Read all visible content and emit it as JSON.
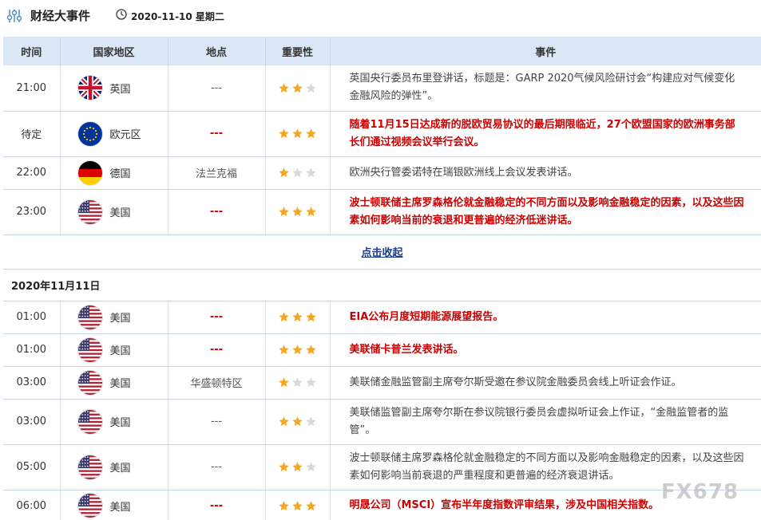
{
  "header": {
    "title": "财经大事件",
    "date": "2020-11-10 星期二"
  },
  "columns": [
    "时间",
    "国家地区",
    "地点",
    "重要性",
    "事件"
  ],
  "rows_day1": [
    {
      "time": "21:00",
      "country": "英国",
      "flag": "uk",
      "place": "---",
      "place_red": false,
      "stars": 2,
      "event": "英国央行委员布里登讲话，标题是：GARP 2020气候风险研讨会“构建应对气候变化金融风险的弹性”。",
      "important": false
    },
    {
      "time": "待定",
      "country": "欧元区",
      "flag": "eu",
      "place": "---",
      "place_red": true,
      "stars": 3,
      "event": "随着11月15日达成新的脱欧贸易协议的最后期限临近，27个欧盟国家的欧洲事务部长们通过视频会议举行会议。",
      "important": true
    },
    {
      "time": "22:00",
      "country": "德国",
      "flag": "de",
      "place": "法兰克福",
      "place_red": false,
      "stars": 1,
      "event": "欧洲央行管委诺特在瑞银欧洲线上会议发表讲话。",
      "important": false
    },
    {
      "time": "23:00",
      "country": "美国",
      "flag": "us",
      "place": "---",
      "place_red": true,
      "stars": 3,
      "event": "波士顿联储主席罗森格伦就金融稳定的不同方面以及影响金融稳定的因素，以及这些因素如何影响当前的衰退和更普遍的经济低迷讲话。",
      "important": true
    }
  ],
  "collapse_label": "点击收起",
  "day2_label": "2020年11月11日",
  "rows_day2": [
    {
      "time": "01:00",
      "country": "美国",
      "flag": "us",
      "place": "---",
      "place_red": true,
      "stars": 3,
      "event": "EIA公布月度短期能源展望报告。",
      "important": true
    },
    {
      "time": "01:00",
      "country": "美国",
      "flag": "us",
      "place": "---",
      "place_red": true,
      "stars": 3,
      "event": "美联储卡普兰发表讲话。",
      "important": true
    },
    {
      "time": "03:00",
      "country": "美国",
      "flag": "us",
      "place": "华盛顿特区",
      "place_red": false,
      "stars": 1,
      "event": "美联储金融监管副主席夸尔斯受邀在参议院金融委员会线上听证会作证。",
      "important": false
    },
    {
      "time": "03:00",
      "country": "美国",
      "flag": "us",
      "place": "---",
      "place_red": false,
      "stars": 2,
      "event": "美联储监管副主席夸尔斯在参议院银行委员会虚拟听证会上作证，“金融监管者的监管”。",
      "important": false
    },
    {
      "time": "05:00",
      "country": "美国",
      "flag": "us",
      "place": "---",
      "place_red": false,
      "stars": 2,
      "event": "波士顿联储主席罗森格伦就金融稳定的不同方面以及影响金融稳定的因素，以及这些因素如何影响当前衰退的严重程度和更普遍的经济衰退讲话。",
      "important": false
    },
    {
      "time": "06:00",
      "country": "美国",
      "flag": "us",
      "place": "---",
      "place_red": true,
      "stars": 3,
      "event": "明晟公司（MSCI）宣布半年度指数评审结果，涉及中国相关指数。",
      "important": true
    }
  ],
  "watermark": "FX678",
  "colors": {
    "header_bg": "#dbe7f6",
    "star_on": "#f5a623",
    "star_off": "#d9d9d9",
    "important_text": "#cc0000"
  }
}
